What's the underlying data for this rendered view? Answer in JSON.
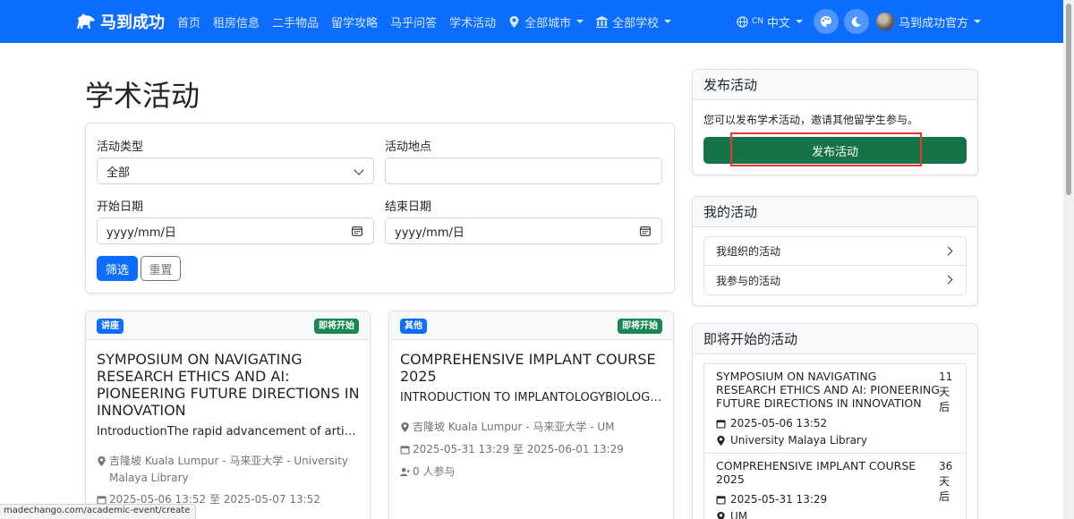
{
  "nav": {
    "brand": "马到成功",
    "links": [
      "首页",
      "租房信息",
      "二手物品",
      "留学攻略",
      "马乎问答",
      "学术活动"
    ],
    "city": "全部城市",
    "school": "全部学校",
    "lang_code": "CN",
    "lang": "中文",
    "user": "马到成功官方"
  },
  "main": {
    "title": "学术活动",
    "filter": {
      "type_label": "活动类型",
      "type_value": "全部",
      "location_label": "活动地点",
      "location_value": "",
      "start_label": "开始日期",
      "start_value": "yyyy/mm/日",
      "end_label": "结束日期",
      "end_value": "yyyy/mm/日",
      "submit": "筛选",
      "reset": "重置"
    },
    "events": [
      {
        "category": "讲座",
        "status": "即将开始",
        "title": "SYMPOSIUM ON NAVIGATING RESEARCH ETHICS AND AI: PIONEERING FUTURE DIRECTIONS IN INNOVATION",
        "description": "IntroductionThe rapid advancement of artificia...",
        "location": "吉隆坡 Kuala Lumpur - 马来亚大学 - University Malaya Library",
        "time": "2025-05-06 13:52 至 2025-05-07 13:52"
      },
      {
        "category": "其他",
        "status": "即将开始",
        "title": "COMPREHENSIVE IMPLANT COURSE 2025",
        "description": "INTRODUCTION TO IMPLANTOLOGYBIOLOGIC...",
        "location": "吉隆坡 Kuala Lumpur - 马来亚大学 - UM",
        "time": "2025-05-31 13:29 至 2025-06-01 13:29",
        "participants": "0 人参与"
      }
    ]
  },
  "sidebar": {
    "publish": {
      "header": "发布活动",
      "text": "您可以发布学术活动，邀请其他留学生参与。",
      "button": "发布活动"
    },
    "my": {
      "header": "我的活动",
      "items": [
        "我组织的活动",
        "我参与的活动"
      ]
    },
    "upcoming": {
      "header": "即将开始的活动",
      "items": [
        {
          "title": "SYMPOSIUM ON NAVIGATING RESEARCH ETHICS AND AI: PIONEERING FUTURE DIRECTIONS IN INNOVATION",
          "days": "11 天 后",
          "date": "2025-05-06 13:52",
          "place": "University Malaya Library"
        },
        {
          "title": "COMPREHENSIVE IMPLANT COURSE 2025",
          "days": "36 天 后",
          "date": "2025-05-31 13:29",
          "place": "UM"
        }
      ]
    }
  },
  "status_url": "madechango.com/academic-event/create"
}
